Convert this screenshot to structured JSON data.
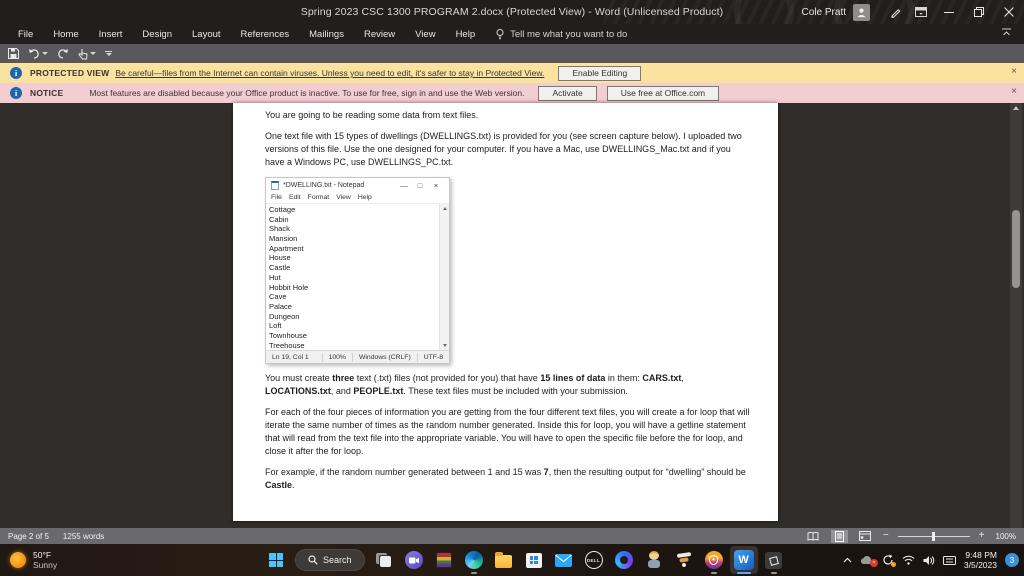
{
  "colors": {
    "titlebar_bg": "#211f1e",
    "qat_gray": "#5a585b",
    "protected_yellow": "#fbe29e",
    "notice_pink": "#f2cdd1",
    "doc_bg": "#312d2b",
    "word_blue": "#185abd",
    "win_accent": "#4cc2ff",
    "badge_blue": "#3d8fd6"
  },
  "titlebar": {
    "title": "Spring 2023 CSC 1300 PROGRAM 2.docx (Protected View)  -  Word (Unlicensed Product)",
    "user_name": "Cole Pratt"
  },
  "menubar": {
    "items": [
      "File",
      "Home",
      "Insert",
      "Design",
      "Layout",
      "References",
      "Mailings",
      "Review",
      "View",
      "Help"
    ],
    "tell_me": "Tell me what you want to do"
  },
  "bars": {
    "protected": {
      "label": "PROTECTED VIEW",
      "message": "Be careful—files from the Internet can contain viruses. Unless you need to edit, it's safer to stay in Protected View.",
      "button": "Enable Editing"
    },
    "notice": {
      "label": "NOTICE",
      "message": "Most features are disabled because your Office product is inactive. To use for free, sign in and use the Web version.",
      "activate": "Activate",
      "use_free": "Use free at Office.com"
    }
  },
  "document": {
    "p1": "You are going to be reading some data from text files.",
    "p2": "One text file with 15 types of dwellings (DWELLINGS.txt) is provided for you (see screen capture below).  I uploaded two versions of this file.  Use the one designed for your computer.  If you have a Mac, use DWELLINGS_Mac.txt and if you have a Windows PC, use DWELLINGS_PC.txt.",
    "p3": {
      "s1": "You must create ",
      "s2": "three",
      "s3": " text (.txt) files (not provided for you) that have ",
      "s4": "15 lines of data",
      "s5": " in them:  ",
      "s6": "CARS.txt",
      "s7": ", ",
      "s8": "LOCATIONS.txt",
      "s9": ", and ",
      "s10": "PEOPLE.txt",
      "s11": ".  These text files must be included with your submission."
    },
    "p4": "For each of the four pieces of information you are getting from the four different text files, you will create a for loop that will iterate the same number of times as the random number generated.  Inside this for loop, you will have a getline statement that will read from the text file into the appropriate variable.  You will have to open the specific file before the for loop, and close it after the for loop.",
    "p5": {
      "s1": "For example, if the random number generated between 1 and 15 was ",
      "s2": "7",
      "s3": ", then the resulting output for “dwelling” should be ",
      "s4": "Castle",
      "s5": "."
    }
  },
  "notepad": {
    "title": "*DWELLING.txt - Notepad",
    "menu": [
      "File",
      "Edit",
      "Format",
      "View",
      "Help"
    ],
    "controls": {
      "minimize": "—",
      "maximize": "□",
      "close": "×"
    },
    "lines": [
      "Cottage",
      "Cabin",
      "Shack",
      "Mansion",
      "Apartment",
      "House",
      "Castle",
      "Hut",
      "Hobbit Hole",
      "Cave",
      "Palace",
      "Dungeon",
      "Loft",
      "Townhouse",
      "Treehouse"
    ],
    "status": {
      "ln": "Ln 19, Col 1",
      "zoom": "100%",
      "eol": "Windows (CRLF)",
      "enc": "UTF-8"
    }
  },
  "statusbar": {
    "page": "Page 2 of 5",
    "words": "1255 words",
    "zoom_minus": "−",
    "zoom_plus": "+",
    "zoom_level": "100%"
  },
  "taskbar": {
    "weather_temp": "50°F",
    "weather_cond": "Sunny",
    "search_label": "Search",
    "dell_label": "DELL",
    "word_letter": "W",
    "tray": {
      "time": "9:48 PM",
      "date": "3/5/2023",
      "badge": "3"
    }
  }
}
